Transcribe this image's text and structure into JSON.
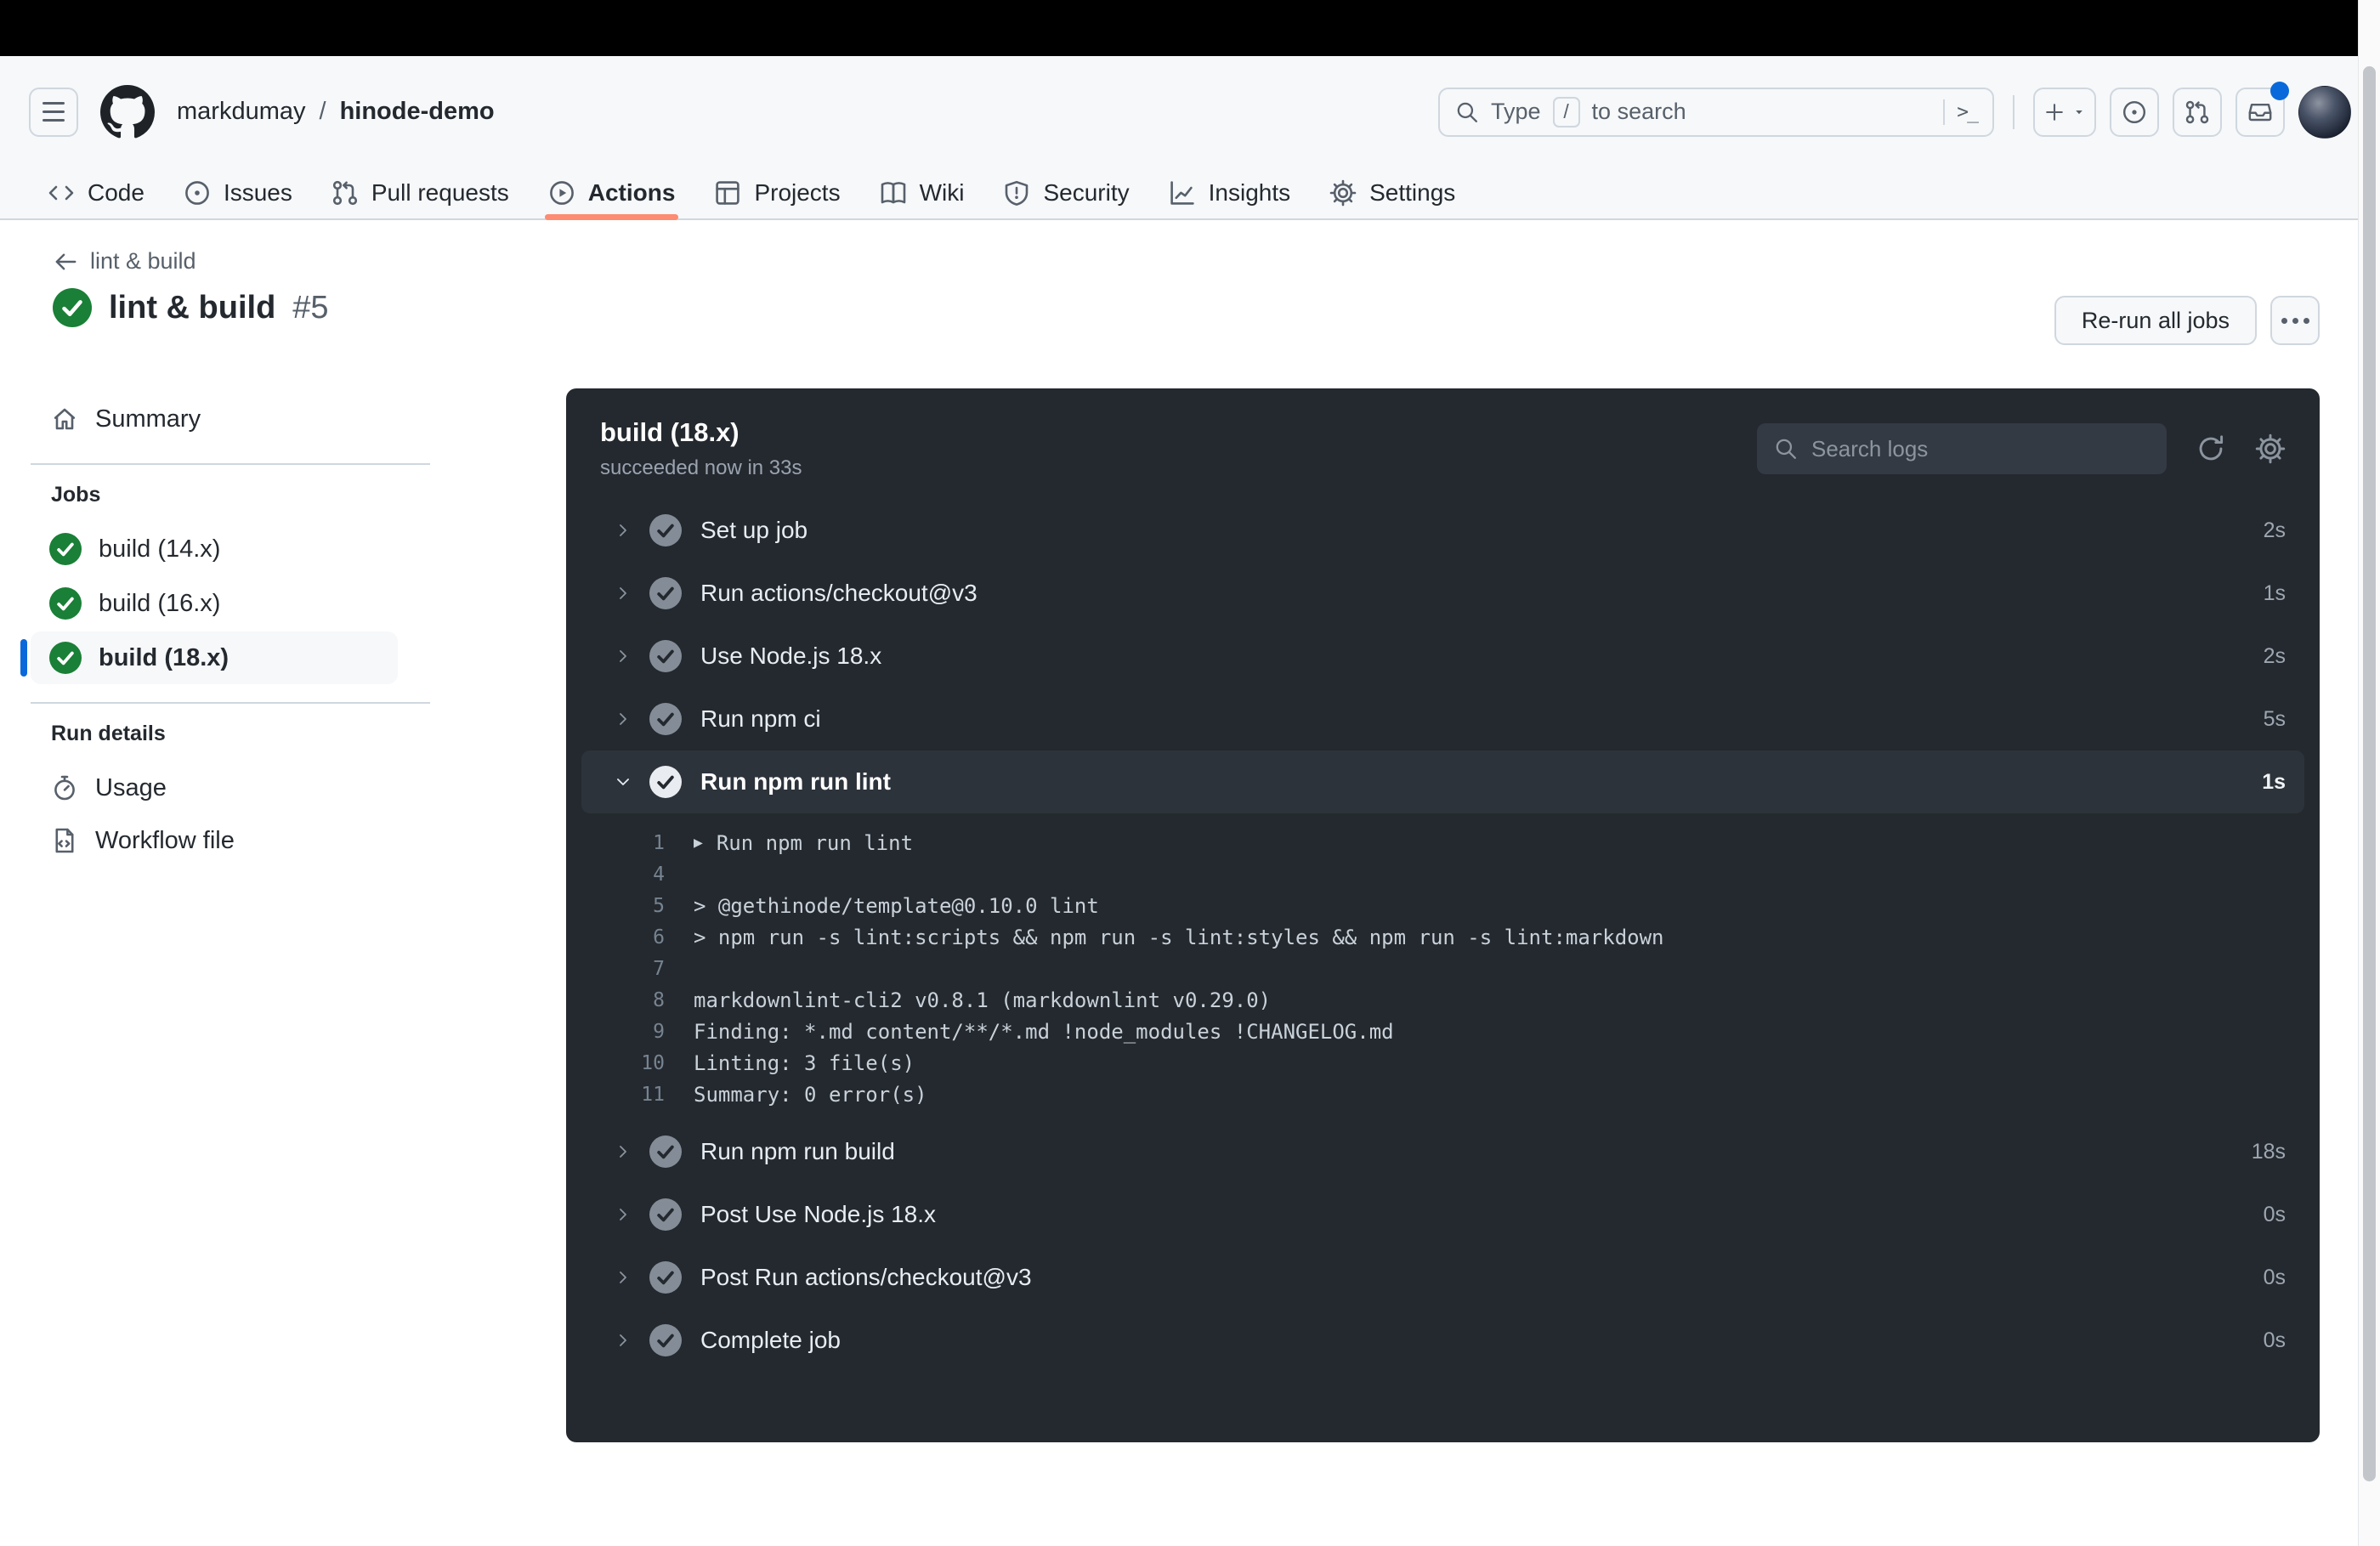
{
  "colors": {
    "success_green": "#1a7f37",
    "tab_accent_orange": "#fd8c73",
    "selected_blue": "#0969da",
    "notification_blue": "#0969da"
  },
  "top_nav": {
    "breadcrumb": {
      "owner": "markdumay",
      "separator": "/",
      "repo": "hinode-demo"
    },
    "search": {
      "prefix": "Type",
      "key": "/",
      "suffix": "to search",
      "command_glyph": ">_"
    }
  },
  "repo_tabs": [
    {
      "label": "Code"
    },
    {
      "label": "Issues"
    },
    {
      "label": "Pull requests"
    },
    {
      "label": "Actions"
    },
    {
      "label": "Projects"
    },
    {
      "label": "Wiki"
    },
    {
      "label": "Security"
    },
    {
      "label": "Insights"
    },
    {
      "label": "Settings"
    }
  ],
  "run_header": {
    "back_label": "lint & build",
    "title": "lint & build",
    "run_number": "#5",
    "rerun_button": "Re-run all jobs"
  },
  "sidebar": {
    "summary_label": "Summary",
    "jobs_heading": "Jobs",
    "jobs": [
      {
        "label": "build (14.x)",
        "selected": false
      },
      {
        "label": "build (16.x)",
        "selected": false
      },
      {
        "label": "build (18.x)",
        "selected": true
      }
    ],
    "run_details_heading": "Run details",
    "usage_label": "Usage",
    "workflow_file_label": "Workflow file"
  },
  "job_panel": {
    "title": "build (18.x)",
    "status": "succeeded now in 33s",
    "search_placeholder": "Search logs",
    "steps_before": [
      {
        "label": "Set up job",
        "duration": "2s"
      },
      {
        "label": "Run actions/checkout@v3",
        "duration": "1s"
      },
      {
        "label": "Use Node.js 18.x",
        "duration": "2s"
      },
      {
        "label": "Run npm ci",
        "duration": "5s"
      }
    ],
    "expanded_step": {
      "label": "Run npm run lint",
      "duration": "1s"
    },
    "log_lines": [
      {
        "num": "1",
        "text": "Run npm run lint",
        "toggle": true
      },
      {
        "num": "4",
        "text": ""
      },
      {
        "num": "5",
        "text": "> @gethinode/template@0.10.0 lint"
      },
      {
        "num": "6",
        "text": "> npm run -s lint:scripts && npm run -s lint:styles && npm run -s lint:markdown"
      },
      {
        "num": "7",
        "text": ""
      },
      {
        "num": "8",
        "text": "markdownlint-cli2 v0.8.1 (markdownlint v0.29.0)"
      },
      {
        "num": "9",
        "text": "Finding: *.md content/**/*.md !node_modules !CHANGELOG.md"
      },
      {
        "num": "10",
        "text": "Linting: 3 file(s)"
      },
      {
        "num": "11",
        "text": "Summary: 0 error(s)"
      }
    ],
    "steps_after": [
      {
        "label": "Run npm run build",
        "duration": "18s"
      },
      {
        "label": "Post Use Node.js 18.x",
        "duration": "0s"
      },
      {
        "label": "Post Run actions/checkout@v3",
        "duration": "0s"
      },
      {
        "label": "Complete job",
        "duration": "0s"
      }
    ]
  }
}
